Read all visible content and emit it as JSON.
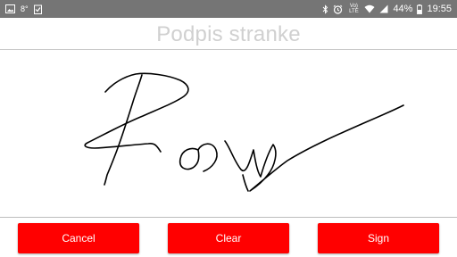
{
  "status_bar": {
    "left_icons": [
      "gallery-icon",
      "weather-icon",
      "clipboard-check-icon"
    ],
    "temperature": "8°",
    "right_icons": [
      "bluetooth-icon",
      "alarm-icon",
      "volte-icon",
      "wifi-icon",
      "signal-icon",
      "battery-icon"
    ],
    "volte_label": "Vo) LTE",
    "battery": "44%",
    "time": "19:55"
  },
  "header": {
    "title": "Podpis stranke"
  },
  "signature_pad": {
    "has_signature": true,
    "stroke_color": "#000000"
  },
  "actions": {
    "cancel_label": "Cancel",
    "clear_label": "Clear",
    "sign_label": "Sign"
  },
  "colors": {
    "status_bar_bg": "#757575",
    "button_bg": "#ff0000",
    "button_text": "#ffffff",
    "title_text": "#d0d0d0"
  }
}
